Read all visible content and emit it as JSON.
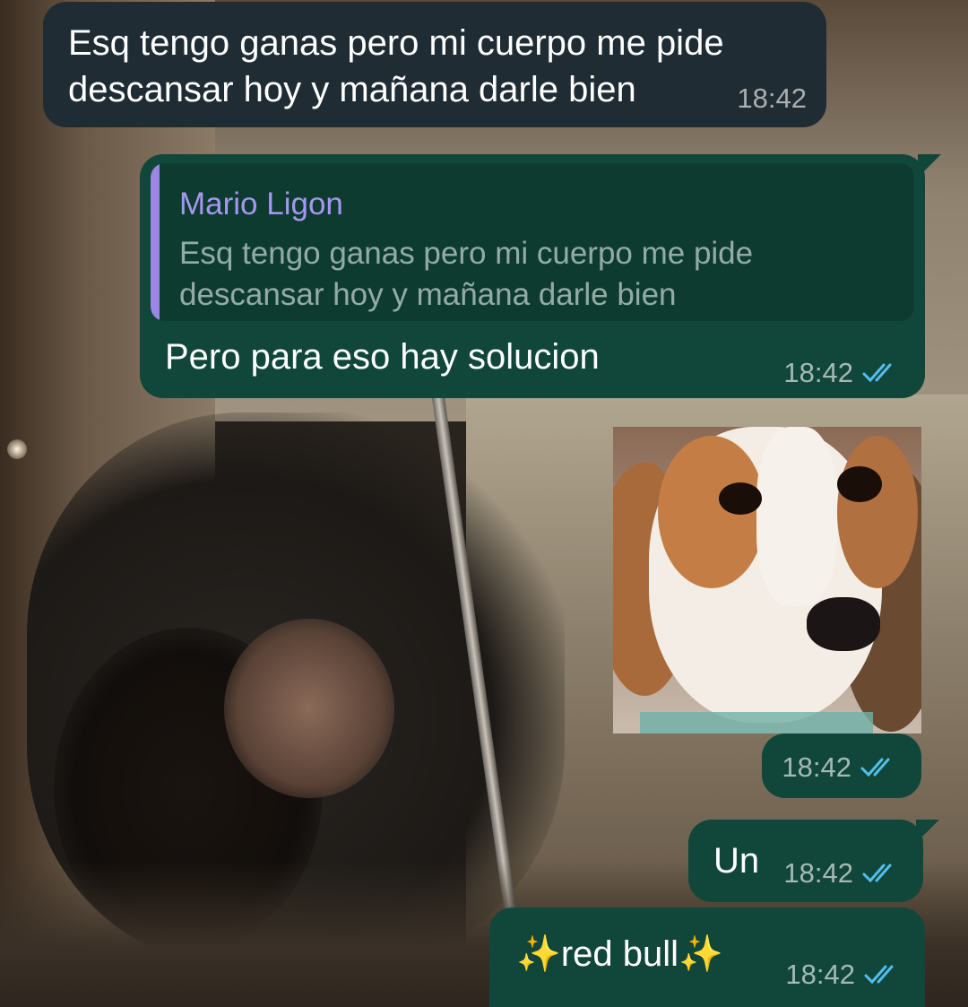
{
  "chat": {
    "messages": [
      {
        "direction": "incoming",
        "text": "Esq tengo ganas pero mi cuerpo me pide\ndescansar hoy y mañana darle bien",
        "time": "18:42"
      },
      {
        "direction": "outgoing",
        "reply_to": {
          "author": "Mario Ligon",
          "text": "Esq tengo ganas pero mi cuerpo me pide\ndescansar hoy y mañana darle bien"
        },
        "text": "Pero para eso hay solucion",
        "time": "18:42",
        "status": "read"
      },
      {
        "direction": "outgoing",
        "type": "sticker",
        "sticker": "beagle-dog-sticker",
        "time": "18:42",
        "status": "read"
      },
      {
        "direction": "outgoing",
        "text": "Un",
        "time": "18:42",
        "status": "read"
      },
      {
        "direction": "outgoing",
        "text_prefix": "✨",
        "text": "red bull",
        "text_suffix": "✨",
        "time": "18:42",
        "status": "read"
      }
    ]
  },
  "colors": {
    "incoming_bubble": "#1f2c33",
    "outgoing_bubble": "#11473a",
    "read_ticks": "#53bdeb",
    "quote_author": "#a796f0",
    "quote_bar": "#9b86e6"
  },
  "icons": {
    "read_receipt": "double-check-icon",
    "sparkles": "sparkles-emoji"
  }
}
